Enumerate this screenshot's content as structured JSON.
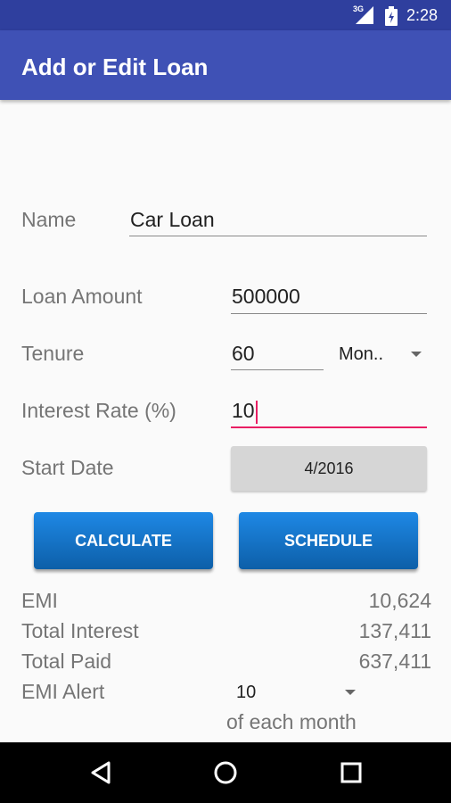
{
  "status_bar": {
    "network": "3G",
    "time": "2:28",
    "icons": [
      "signal-icon",
      "battery-icon"
    ]
  },
  "app_bar": {
    "title": "Add or Edit Loan"
  },
  "form": {
    "name_label": "Name",
    "name_value": "Car Loan",
    "loan_amount_label": "Loan Amount",
    "loan_amount_value": "500000",
    "tenure_label": "Tenure",
    "tenure_value": "60",
    "tenure_unit": "Mon..",
    "interest_rate_label": "Interest Rate (%)",
    "interest_rate_value": "10",
    "start_date_label": "Start Date",
    "start_date_value": "4/2016"
  },
  "buttons": {
    "calculate": "CALCULATE",
    "schedule": "SCHEDULE"
  },
  "results": {
    "emi_label": "EMI",
    "emi_value": "10,624",
    "total_interest_label": "Total Interest",
    "total_interest_value": "137,411",
    "total_paid_label": "Total Paid",
    "total_paid_value": "637,411",
    "emi_alert_label": "EMI Alert",
    "emi_alert_value": "10",
    "emi_alert_suffix": "of each month"
  },
  "nav_bar": {
    "icons": [
      "back-icon",
      "home-icon",
      "recents-icon"
    ]
  },
  "colors": {
    "primary": "#3f51b5",
    "primary_dark": "#2f3f9e",
    "accent": "#e91e63",
    "button_blue": "#1976d2"
  }
}
